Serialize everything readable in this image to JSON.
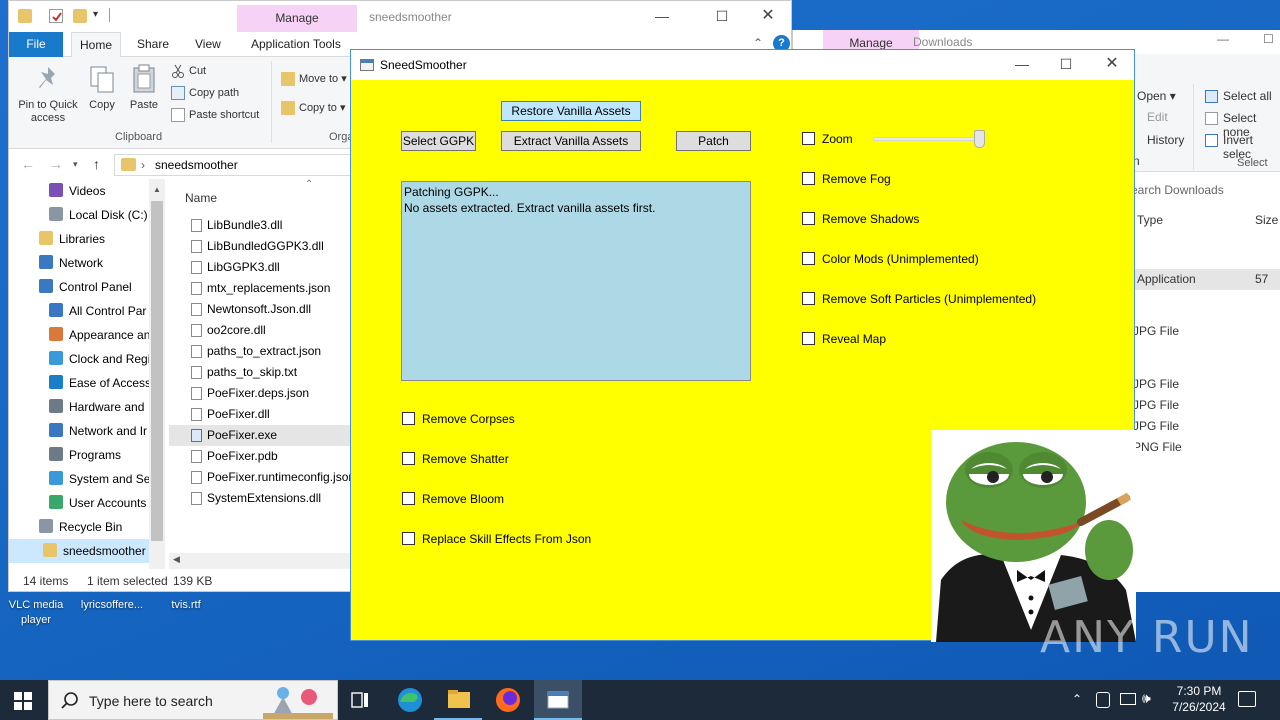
{
  "explorer": {
    "title": "sneedsmoother",
    "manage_tab": "Manage",
    "tabs": {
      "file": "File",
      "home": "Home",
      "share": "Share",
      "view": "View",
      "app_tools": "Application Tools"
    },
    "ribbon": {
      "pin": "Pin to Quick access",
      "copy": "Copy",
      "paste": "Paste",
      "cut": "Cut",
      "copy_path": "Copy path",
      "paste_shortcut": "Paste shortcut",
      "clipboard_group": "Clipboard",
      "move_to": "Move to",
      "copy_to": "Copy to",
      "organize_group": "Orga"
    },
    "address": "sneedsmoother",
    "column_name": "Name",
    "nav": [
      "Videos",
      "Local Disk (C:)",
      "Libraries",
      "Network",
      "Control Panel",
      "All Control Par",
      "Appearance an",
      "Clock and Regi",
      "Ease of Access",
      "Hardware and",
      "Network and Ir",
      "Programs",
      "System and Se",
      "User Accounts",
      "Recycle Bin",
      "sneedsmoother"
    ],
    "files": [
      "LibBundle3.dll",
      "LibBundledGGPK3.dll",
      "LibGGPK3.dll",
      "mtx_replacements.json",
      "Newtonsoft.Json.dll",
      "oo2core.dll",
      "paths_to_extract.json",
      "paths_to_skip.txt",
      "PoeFixer.deps.json",
      "PoeFixer.dll",
      "PoeFixer.exe",
      "PoeFixer.pdb",
      "PoeFixer.runtimeconfig.json",
      "SystemExtensions.dll"
    ],
    "status": {
      "count": "14 items",
      "selected": "1 item selected",
      "size": "139 KB"
    }
  },
  "downloads": {
    "manage_tab": "Manage",
    "title": "Downloads",
    "ribbon": {
      "open": "Open",
      "edit": "Edit",
      "history": "History",
      "select_all": "Select all",
      "select_none": "Select none",
      "invert": "Invert selec",
      "select_group": "Select",
      "n": "n"
    },
    "search_placeholder": "earch Downloads",
    "col_type": "Type",
    "col_size": "Size",
    "rows": [
      {
        "type": "Application",
        "size": "57"
      },
      {
        "type": "JPG File"
      },
      {
        "type": "JPG File"
      },
      {
        "type": "JPG File"
      },
      {
        "type": "JPG File"
      },
      {
        "type": "PNG File"
      }
    ]
  },
  "desktop": {
    "icons": [
      "VLC media player",
      "lyricsoffere...",
      "tvis.rtf"
    ]
  },
  "sneed": {
    "title": "SneedSmoother",
    "buttons": {
      "restore": "Restore Vanilla Assets",
      "select": "Select GGPK",
      "extract": "Extract Vanilla Assets",
      "patch": "Patch"
    },
    "log": [
      "Patching GGPK...",
      "No assets extracted. Extract vanilla assets first."
    ],
    "options_right": [
      "Zoom",
      "Remove Fog",
      "Remove Shadows",
      "Color Mods (Unimplemented)",
      "Remove Soft Particles (Unimplemented)",
      "Reveal Map"
    ],
    "options_left": [
      "Remove Corpses",
      "Remove Shatter",
      "Remove Bloom",
      "Replace Skill Effects From Json"
    ],
    "zoom_level": 1.0
  },
  "taskbar": {
    "search_placeholder": "Type here to search",
    "time": "7:30 PM",
    "date": "7/26/2024"
  },
  "watermark": "ANY RUN",
  "colors": {
    "sneed_bg": "#ffff00",
    "log_bg": "#add8e6",
    "accent": "#1979ca",
    "manage": "#f6d2f7"
  }
}
